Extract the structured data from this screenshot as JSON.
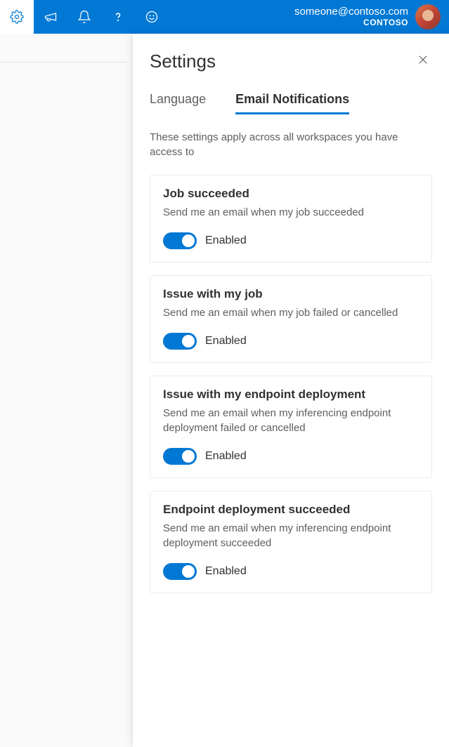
{
  "header": {
    "user_email": "someone@contoso.com",
    "org": "CONTOSO"
  },
  "panel": {
    "title": "Settings",
    "tabs": [
      {
        "label": "Language",
        "active": false
      },
      {
        "label": "Email Notifications",
        "active": true
      }
    ],
    "description": "These settings apply across all workspaces you have access to",
    "cards": [
      {
        "title": "Job succeeded",
        "desc": "Send me an email when my job succeeded",
        "toggle_label": "Enabled"
      },
      {
        "title": "Issue with my job",
        "desc": "Send me an email when my job failed or cancelled",
        "toggle_label": "Enabled"
      },
      {
        "title": "Issue with my endpoint deployment",
        "desc": "Send me an email when my inferencing endpoint deployment failed or cancelled",
        "toggle_label": "Enabled"
      },
      {
        "title": "Endpoint deployment succeeded",
        "desc": "Send me an email when my inferencing endpoint deployment succeeded",
        "toggle_label": "Enabled"
      }
    ]
  }
}
